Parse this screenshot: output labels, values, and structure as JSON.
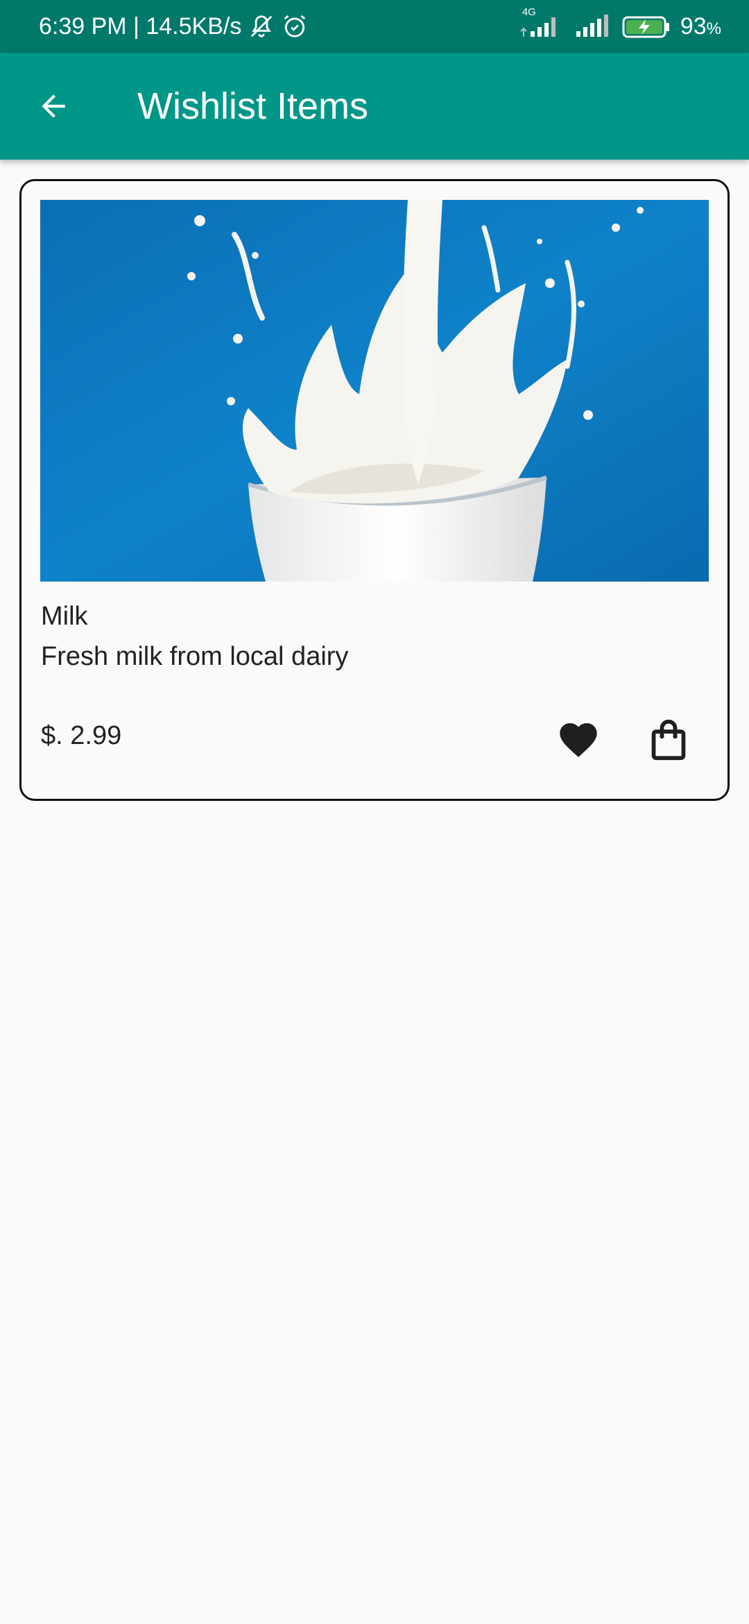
{
  "status_bar": {
    "time_speed": "6:39 PM | 14.5KB/s",
    "network_label": "4G",
    "battery_percent": "93",
    "battery_unit": "%"
  },
  "app_bar": {
    "title": "Wishlist Items",
    "back_icon": "arrow-back-icon"
  },
  "wishlist": {
    "items": [
      {
        "name": "Milk",
        "description": "Fresh milk from local dairy",
        "price": "$. 2.99",
        "image": "milk-splash-glass",
        "favorite_icon": "heart-icon",
        "cart_icon": "shopping-bag-icon"
      }
    ]
  },
  "colors": {
    "status_bar": "#00796b",
    "app_bar": "#009688",
    "background": "#fafafa",
    "image_blue": "#0a7cc0"
  }
}
